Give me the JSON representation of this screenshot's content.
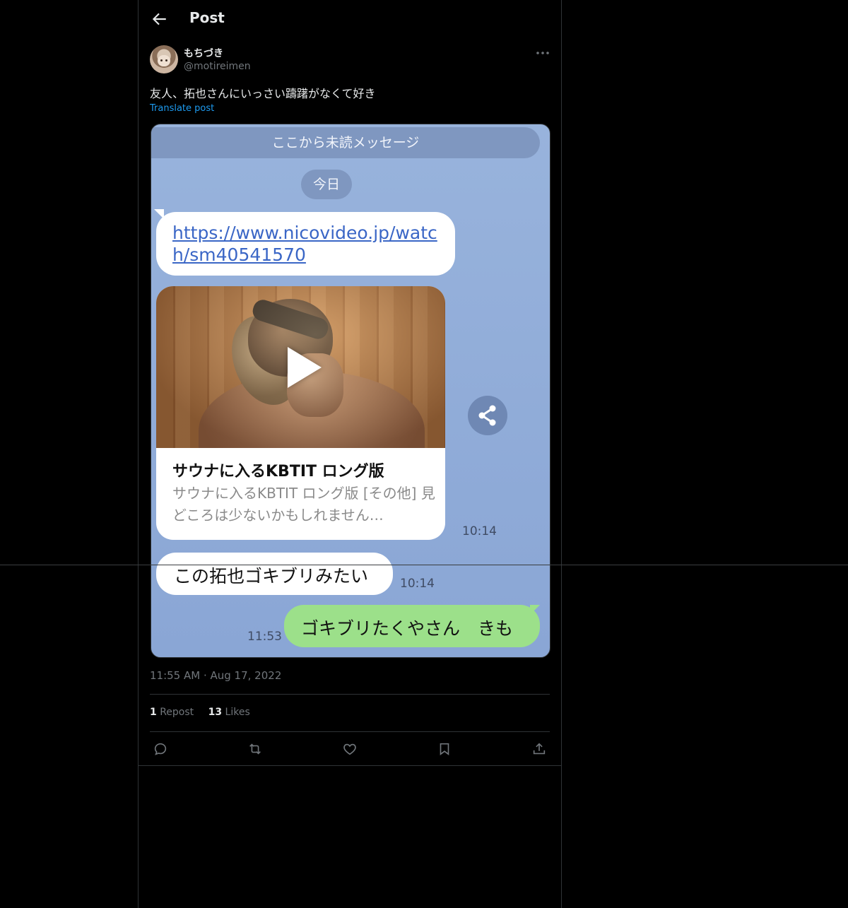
{
  "header": {
    "title": "Post"
  },
  "author": {
    "display_name": "もちづき",
    "handle": "@motireimen"
  },
  "tweet": {
    "text": "友人、拓也さんにいっさい躊躇がなくて好き",
    "translate_label": "Translate post",
    "timestamp": "11:55 AM · Aug 17, 2022"
  },
  "stats": {
    "reposts_count": "1",
    "reposts_label": "Repost",
    "likes_count": "13",
    "likes_label": "Likes"
  },
  "chat": {
    "unread_label": "ここから未読メッセージ",
    "date_label": "今日",
    "link": "https://www.nicovideo.jp/watch/sm40541570",
    "card_title": "サウナに入るKBTIT ロング版",
    "card_desc": "サウナに入るKBTIT ロング版 [その他] 見どころは少ないかもしれません…",
    "card_time": "10:14",
    "message1": "この拓也ゴキブリみたい",
    "message1_time": "10:14",
    "message2": "ゴキブリたくやさん　きも",
    "message2_time": "11:53"
  },
  "icons": [
    "back-arrow-icon",
    "more-icon",
    "play-icon",
    "share-icon",
    "reply-icon",
    "repost-icon",
    "like-icon",
    "bookmark-icon",
    "upload-icon"
  ],
  "colors": {
    "accent": "#1d9bf0",
    "chat_bg": "#8aa6d5",
    "own_bubble": "#9ce08a"
  }
}
